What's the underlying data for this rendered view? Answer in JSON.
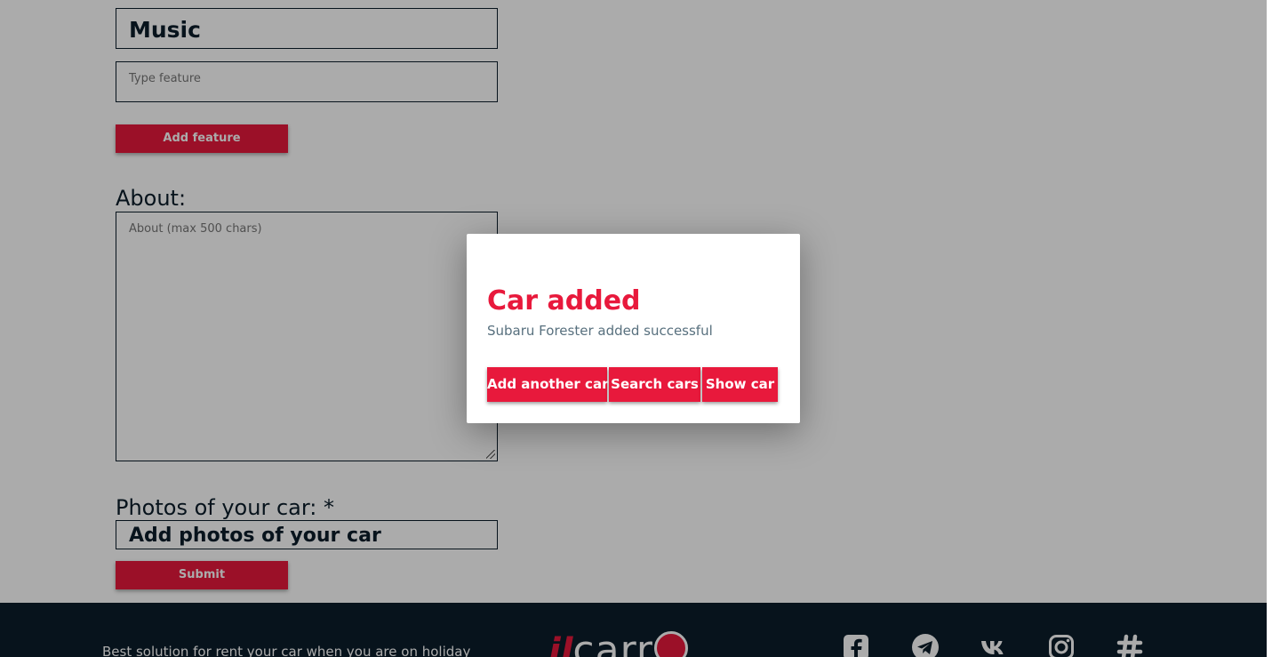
{
  "form": {
    "feature_value": "Music",
    "feature_placeholder": "Type feature",
    "add_feature_label": "Add feature",
    "about_label": "About:",
    "about_placeholder": "About (max 500 chars)",
    "photos_label": "Photos of your car: *",
    "photos_button_label": "Add photos of your car",
    "submit_label": "Submit"
  },
  "footer": {
    "tagline": "Best solution for rent your car when you are on holiday",
    "logo_prefix": "il",
    "logo_main": "carr",
    "social_icons": [
      "facebook-icon",
      "telegram-icon",
      "vk-icon",
      "instagram-icon",
      "slack-icon"
    ]
  },
  "dialog": {
    "title": "Car added",
    "message": "Subaru Forester added successful",
    "buttons": {
      "add_another": "Add another car",
      "search": "Search cars",
      "show": "Show car"
    }
  },
  "colors": {
    "accent": "#e8193c",
    "footer_bg": "#0b1d2a",
    "text_dark": "#0b1d2a",
    "message_text": "#58707e"
  }
}
